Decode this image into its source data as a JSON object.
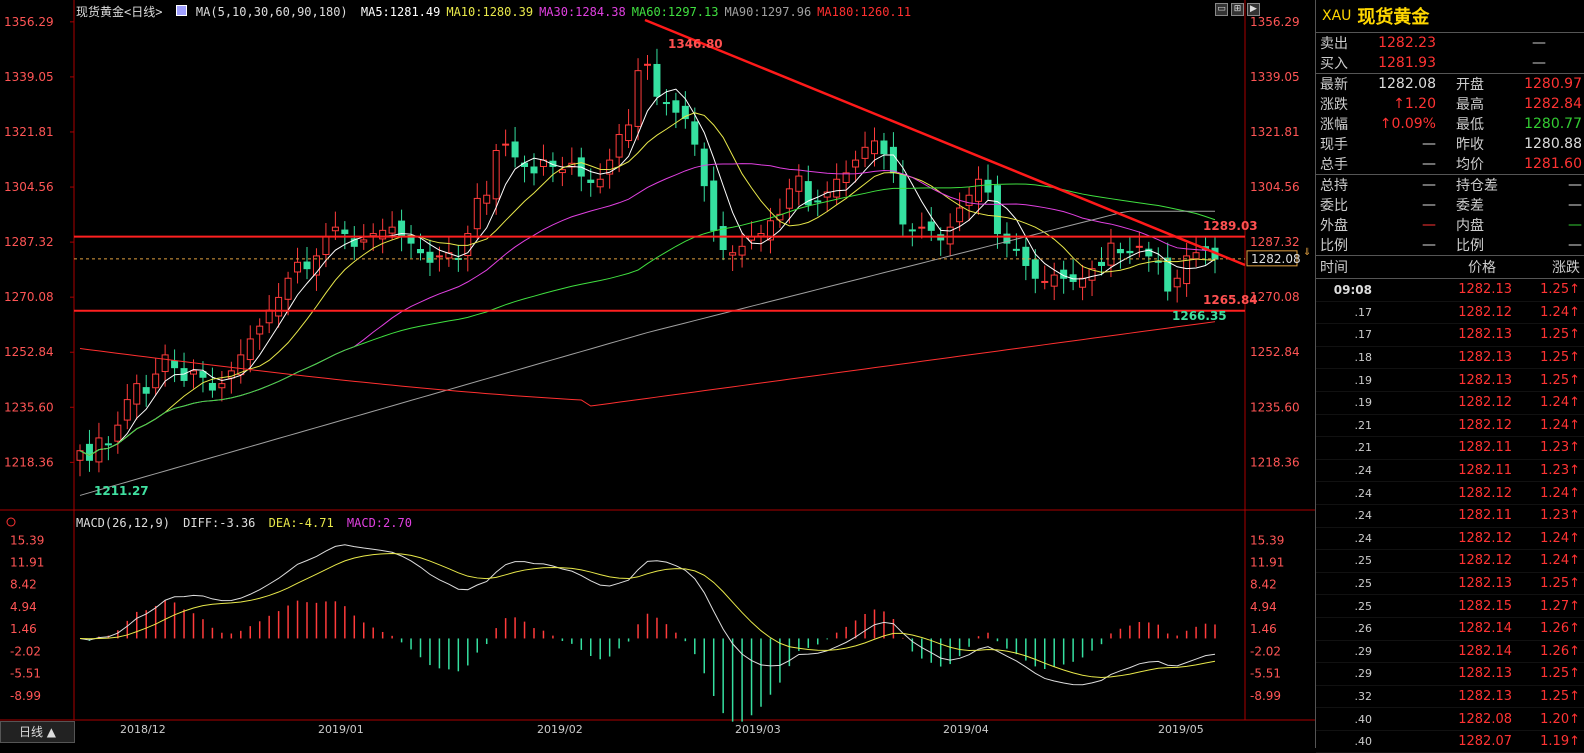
{
  "chart": {
    "title": "现货黄金<日线>",
    "ma_params": "MA(5,10,30,60,90,180)",
    "ma_values": [
      {
        "label": "MA5:1281.49",
        "color": "#ffffff"
      },
      {
        "label": "MA10:1280.39",
        "color": "#e8e84a"
      },
      {
        "label": "MA30:1284.38",
        "color": "#e040e0"
      },
      {
        "label": "MA60:1297.13",
        "color": "#40e040"
      },
      {
        "label": "MA90:1297.96",
        "color": "#a0a0a0"
      },
      {
        "label": "MA180:1260.11",
        "color": "#ff3030"
      }
    ],
    "price_ticks": [
      "1356.29",
      "1339.05",
      "1321.81",
      "1304.56",
      "1287.32",
      "1270.08",
      "1252.84",
      "1235.60",
      "1218.36"
    ],
    "annotations": {
      "high": "1346.80",
      "low": "1211.27",
      "resistance": "1289.03",
      "support": "1265.84",
      "recent_low": "1266.35",
      "current": "1282.08"
    },
    "dates": [
      "2018/12",
      "2019/01",
      "2019/02",
      "2019/03",
      "2019/04",
      "2019/05"
    ],
    "period_button": "日线 ▲"
  },
  "macd": {
    "params": "MACD(26,12,9)",
    "diff": "DIFF:-3.36",
    "dea": "DEA:-4.71",
    "macd": "MACD:2.70",
    "ticks": [
      "15.39",
      "11.91",
      "8.42",
      "4.94",
      "1.46",
      "-2.02",
      "-5.51",
      "-8.99"
    ]
  },
  "chart_data": {
    "type": "candlestick",
    "ylim": [
      1205,
      1360
    ],
    "closes": [
      1222,
      1219,
      1226,
      1224,
      1230,
      1238,
      1243,
      1240,
      1246,
      1252,
      1248,
      1244,
      1247,
      1245,
      1241,
      1243,
      1247,
      1252,
      1257,
      1261,
      1266,
      1270,
      1276,
      1281,
      1279,
      1283,
      1289,
      1292,
      1290,
      1286,
      1288,
      1290,
      1291,
      1292,
      1289,
      1287,
      1284,
      1281,
      1283,
      1284,
      1282,
      1290,
      1301,
      1302,
      1316,
      1318,
      1314,
      1311,
      1309,
      1313,
      1311,
      1310,
      1312,
      1308,
      1306,
      1307,
      1313,
      1321,
      1324,
      1341,
      1343,
      1333,
      1331,
      1328,
      1326,
      1318,
      1305,
      1291,
      1285,
      1284,
      1286,
      1289,
      1290,
      1294,
      1296,
      1304,
      1308,
      1299,
      1300,
      1303,
      1307,
      1309,
      1313,
      1317,
      1319,
      1315,
      1309,
      1293,
      1291,
      1292,
      1291,
      1288,
      1292,
      1298,
      1302,
      1307,
      1303,
      1290,
      1287,
      1285,
      1280,
      1276,
      1275,
      1277,
      1276,
      1275,
      1276,
      1279,
      1280,
      1287,
      1284,
      1284,
      1286,
      1283,
      1281,
      1272,
      1276,
      1283,
      1284,
      1285,
      1282
    ]
  },
  "panel": {
    "code": "XAU",
    "name": "现货黄金",
    "bidask": [
      {
        "label": "卖出",
        "value": "1282.23",
        "dash": "—"
      },
      {
        "label": "买入",
        "value": "1281.93",
        "dash": "—"
      }
    ],
    "quote": [
      {
        "l1": "最新",
        "v1": "1282.08",
        "c1": "white",
        "l2": "开盘",
        "v2": "1280.97",
        "c2": "red"
      },
      {
        "l1": "涨跌",
        "v1": "↑1.20",
        "c1": "red",
        "l2": "最高",
        "v2": "1282.84",
        "c2": "red"
      },
      {
        "l1": "涨幅",
        "v1": "↑0.09%",
        "c1": "red",
        "l2": "最低",
        "v2": "1280.77",
        "c2": "green"
      },
      {
        "l1": "现手",
        "v1": "—",
        "c1": "white",
        "l2": "昨收",
        "v2": "1280.88",
        "c2": "white"
      },
      {
        "l1": "总手",
        "v1": "—",
        "c1": "white",
        "l2": "均价",
        "v2": "1281.60",
        "c2": "red"
      }
    ],
    "extra": [
      {
        "l1": "总持",
        "v1": "—",
        "c1": "white",
        "l2": "持仓差",
        "v2": "—",
        "c2": "white"
      },
      {
        "l1": "委比",
        "v1": "—",
        "c1": "white",
        "l2": "委差",
        "v2": "—",
        "c2": "white"
      },
      {
        "l1": "外盘",
        "v1": "—",
        "c1": "red",
        "l2": "内盘",
        "v2": "—",
        "c2": "green"
      },
      {
        "l1": "比例",
        "v1": "—",
        "c1": "white",
        "l2": "比例",
        "v2": "—",
        "c2": "white"
      }
    ],
    "ticks_header": {
      "time": "时间",
      "price": "价格",
      "change": "涨跌"
    },
    "ticks": [
      {
        "t": "09:08",
        "p": "1282.13",
        "c": "1.25↑"
      },
      {
        "t": ".17",
        "p": "1282.12",
        "c": "1.24↑"
      },
      {
        "t": ".17",
        "p": "1282.13",
        "c": "1.25↑"
      },
      {
        "t": ".18",
        "p": "1282.13",
        "c": "1.25↑"
      },
      {
        "t": ".19",
        "p": "1282.13",
        "c": "1.25↑"
      },
      {
        "t": ".19",
        "p": "1282.12",
        "c": "1.24↑"
      },
      {
        "t": ".21",
        "p": "1282.12",
        "c": "1.24↑"
      },
      {
        "t": ".21",
        "p": "1282.11",
        "c": "1.23↑"
      },
      {
        "t": ".24",
        "p": "1282.11",
        "c": "1.23↑"
      },
      {
        "t": ".24",
        "p": "1282.12",
        "c": "1.24↑"
      },
      {
        "t": ".24",
        "p": "1282.11",
        "c": "1.23↑"
      },
      {
        "t": ".24",
        "p": "1282.12",
        "c": "1.24↑"
      },
      {
        "t": ".25",
        "p": "1282.12",
        "c": "1.24↑"
      },
      {
        "t": ".25",
        "p": "1282.13",
        "c": "1.25↑"
      },
      {
        "t": ".25",
        "p": "1282.15",
        "c": "1.27↑"
      },
      {
        "t": ".26",
        "p": "1282.14",
        "c": "1.26↑"
      },
      {
        "t": ".29",
        "p": "1282.14",
        "c": "1.26↑"
      },
      {
        "t": ".29",
        "p": "1282.13",
        "c": "1.25↑"
      },
      {
        "t": ".32",
        "p": "1282.13",
        "c": "1.25↑"
      },
      {
        "t": ".40",
        "p": "1282.08",
        "c": "1.20↑"
      },
      {
        "t": ".40",
        "p": "1282.07",
        "c": "1.19↑"
      }
    ]
  }
}
